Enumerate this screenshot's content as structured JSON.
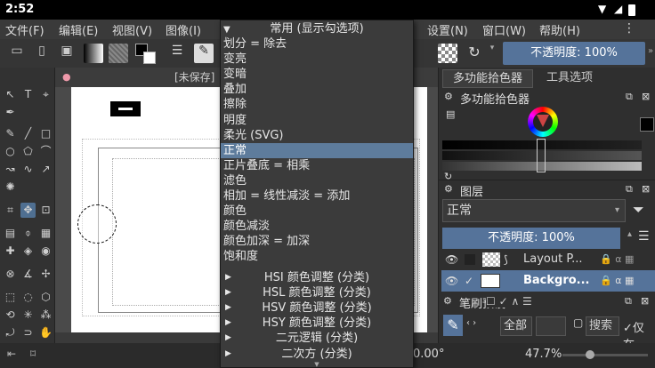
{
  "status": {
    "time": "2:52"
  },
  "menubar": {
    "items": [
      "文件(F)",
      "编辑(E)",
      "视图(V)",
      "图像(I)",
      "设置(N)",
      "窗口(W)",
      "帮助(H)"
    ]
  },
  "toolbar": {
    "opacity_label": "不透明度:  100%"
  },
  "canvas_tab": {
    "title": "[未保存]"
  },
  "blend_menu": {
    "header": "常用 (显示勾选项)",
    "items": [
      {
        "label": "划分 = 除去",
        "selected": false
      },
      {
        "label": "变亮",
        "selected": false
      },
      {
        "label": "变暗",
        "selected": false
      },
      {
        "label": "叠加",
        "selected": false
      },
      {
        "label": "擦除",
        "selected": false
      },
      {
        "label": "明度",
        "selected": false
      },
      {
        "label": "柔光 (SVG)",
        "selected": false
      },
      {
        "label": "正常",
        "selected": true
      },
      {
        "label": "正片叠底 = 相乘",
        "selected": false
      },
      {
        "label": "滤色",
        "selected": false
      },
      {
        "label": "相加 = 线性减淡 = 添加",
        "selected": false
      },
      {
        "label": "颜色",
        "selected": false
      },
      {
        "label": "颜色减淡",
        "selected": false
      },
      {
        "label": "颜色加深 = 加深",
        "selected": false
      },
      {
        "label": "饱和度",
        "selected": false
      }
    ],
    "submenus": [
      "HSI 颜色调整 (分类)",
      "HSL 颜色调整 (分类)",
      "HSV 颜色调整 (分类)",
      "HSY 颜色调整 (分类)",
      "二元逻辑 (分类)",
      "二次方 (分类)"
    ]
  },
  "right_panel": {
    "tabs": [
      "多功能拾色器",
      "工具选项"
    ],
    "color_header": "多功能拾色器",
    "layers_header": "图层",
    "blend_value": "正常",
    "layer_opacity": "不透明度:  100%",
    "layers": [
      {
        "name": "Layout P...",
        "active": false
      },
      {
        "name": "Backgro...",
        "active": true
      }
    ],
    "brush_header": "笔刷预设",
    "brush_filter": "全部",
    "brush_search": "搜索",
    "brush_inplace": "仅在"
  },
  "bottom": {
    "rotation": "0.00°",
    "zoom": "47.7%"
  }
}
